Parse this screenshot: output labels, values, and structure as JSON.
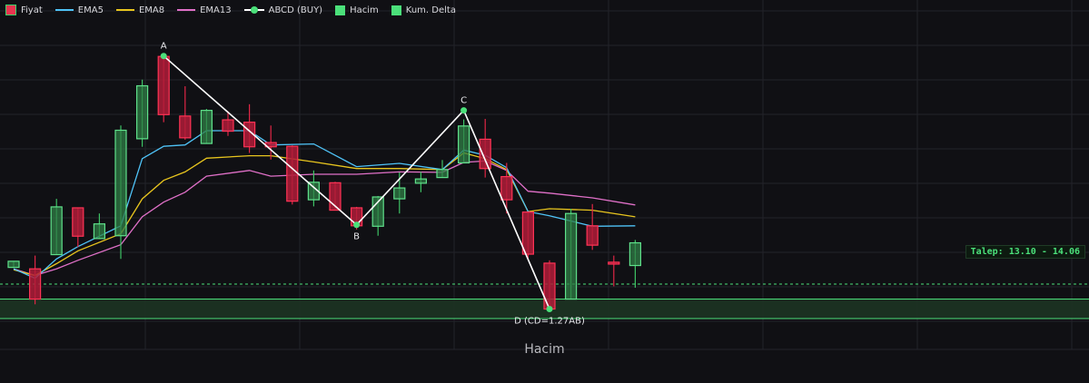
{
  "legend": [
    {
      "icon": "candlestick-icon",
      "label": "Fiyat",
      "style": "candle",
      "color": "#e8354f"
    },
    {
      "icon": "line-icon",
      "label": "EMA5",
      "style": "line",
      "color": "#4fc3f7"
    },
    {
      "icon": "line-icon",
      "label": "EMA8",
      "style": "line",
      "color": "#e8c51e"
    },
    {
      "icon": "line-icon",
      "label": "EMA13",
      "style": "line",
      "color": "#e070c8"
    },
    {
      "icon": "abcd-pattern-icon",
      "label": "ABCD (BUY)",
      "style": "abcd",
      "color": "#ffffff"
    },
    {
      "icon": "square-icon",
      "label": "Hacim",
      "style": "square",
      "color": "#4be07a"
    },
    {
      "icon": "square-icon",
      "label": "Kum. Delta",
      "style": "square",
      "color": "#4be07a"
    }
  ],
  "colors": {
    "background": "#101014",
    "grid": "#22232a",
    "bull": "#3ec264",
    "bear": "#e02645",
    "ema5": "#4fc3f7",
    "ema8": "#e8c51e",
    "ema13": "#e070c8",
    "abcd": "#ffffff",
    "abcd_point": "#4be07a",
    "demand_fill": "#1c3322",
    "demand_line": "#4be07a"
  },
  "demand_zone": {
    "label": "Talep: 13.10 - 14.06",
    "low": 13.1,
    "high": 14.06
  },
  "volume_panel": {
    "title": "Hacim"
  },
  "chart_data": {
    "type": "candlestick",
    "ylim": [
      12.9,
      20.0
    ],
    "candles": [
      {
        "x": 0,
        "o": 14.73,
        "h": 14.86,
        "l": 14.73,
        "c": 14.86
      },
      {
        "x": 1,
        "o": 14.7,
        "h": 14.98,
        "l": 13.95,
        "c": 14.06
      },
      {
        "x": 2,
        "o": 15.0,
        "h": 16.18,
        "l": 15.0,
        "c": 16.01
      },
      {
        "x": 3,
        "o": 15.99,
        "h": 15.99,
        "l": 15.16,
        "c": 15.39
      },
      {
        "x": 4,
        "o": 15.34,
        "h": 15.87,
        "l": 15.34,
        "c": 15.65
      },
      {
        "x": 5,
        "o": 15.4,
        "h": 17.73,
        "l": 14.91,
        "c": 17.63
      },
      {
        "x": 6,
        "o": 17.45,
        "h": 18.7,
        "l": 17.28,
        "c": 18.57
      },
      {
        "x": 7,
        "o": 19.19,
        "h": 19.2,
        "l": 17.8,
        "c": 17.96
      },
      {
        "x": 8,
        "o": 17.93,
        "h": 18.56,
        "l": 17.43,
        "c": 17.47
      },
      {
        "x": 9,
        "o": 17.35,
        "h": 18.08,
        "l": 17.35,
        "c": 18.05
      },
      {
        "x": 10,
        "o": 17.85,
        "h": 18.03,
        "l": 17.51,
        "c": 17.61
      },
      {
        "x": 11,
        "o": 17.8,
        "h": 18.18,
        "l": 17.15,
        "c": 17.28
      },
      {
        "x": 12,
        "o": 17.37,
        "h": 17.73,
        "l": 17.01,
        "c": 17.28
      },
      {
        "x": 13,
        "o": 17.29,
        "h": 17.31,
        "l": 16.06,
        "c": 16.13
      },
      {
        "x": 14,
        "o": 16.16,
        "h": 16.78,
        "l": 16.02,
        "c": 16.53
      },
      {
        "x": 15,
        "o": 16.52,
        "h": 16.54,
        "l": 15.97,
        "c": 15.94
      },
      {
        "x": 16,
        "o": 15.99,
        "h": 16.01,
        "l": 15.53,
        "c": 15.61
      },
      {
        "x": 17,
        "o": 15.6,
        "h": 16.24,
        "l": 15.4,
        "c": 16.22
      },
      {
        "x": 18,
        "o": 16.18,
        "h": 16.74,
        "l": 15.87,
        "c": 16.41
      },
      {
        "x": 19,
        "o": 16.51,
        "h": 16.75,
        "l": 16.32,
        "c": 16.6
      },
      {
        "x": 20,
        "o": 16.63,
        "h": 17.0,
        "l": 16.63,
        "c": 16.8
      },
      {
        "x": 21,
        "o": 16.94,
        "h": 17.86,
        "l": 16.94,
        "c": 17.72
      },
      {
        "x": 22,
        "o": 17.44,
        "h": 17.87,
        "l": 16.63,
        "c": 16.82
      },
      {
        "x": 23,
        "o": 16.65,
        "h": 16.94,
        "l": 15.87,
        "c": 16.16
      },
      {
        "x": 24,
        "o": 15.9,
        "h": 15.91,
        "l": 14.89,
        "c": 15.01
      },
      {
        "x": 25,
        "o": 14.82,
        "h": 14.88,
        "l": 13.85,
        "c": 13.85
      },
      {
        "x": 26,
        "o": 14.06,
        "h": 15.97,
        "l": 14.06,
        "c": 15.87
      },
      {
        "x": 27,
        "o": 15.61,
        "h": 16.07,
        "l": 15.1,
        "c": 15.2
      },
      {
        "x": 28,
        "o": 14.84,
        "h": 14.98,
        "l": 14.33,
        "c": 14.8
      },
      {
        "x": 29,
        "o": 14.77,
        "h": 15.31,
        "l": 14.3,
        "c": 15.25
      }
    ],
    "ema5": [
      [
        0,
        14.7
      ],
      [
        1,
        14.5
      ],
      [
        2,
        14.91
      ],
      [
        3,
        15.17
      ],
      [
        5,
        15.61
      ],
      [
        6,
        17.03
      ],
      [
        7,
        17.29
      ],
      [
        8,
        17.32
      ],
      [
        9,
        17.62
      ],
      [
        11,
        17.62
      ],
      [
        12,
        17.32
      ],
      [
        14,
        17.34
      ],
      [
        16,
        16.86
      ],
      [
        18,
        16.93
      ],
      [
        20,
        16.8
      ],
      [
        21,
        17.21
      ],
      [
        22,
        17.1
      ],
      [
        23,
        16.84
      ],
      [
        24,
        15.91
      ],
      [
        25,
        15.82
      ],
      [
        27,
        15.6
      ],
      [
        29,
        15.61
      ]
    ],
    "ema8": [
      [
        0,
        14.68
      ],
      [
        1,
        14.56
      ],
      [
        2,
        14.81
      ],
      [
        3,
        15.08
      ],
      [
        5,
        15.44
      ],
      [
        6,
        16.18
      ],
      [
        7,
        16.57
      ],
      [
        8,
        16.75
      ],
      [
        9,
        17.04
      ],
      [
        11,
        17.09
      ],
      [
        12,
        17.09
      ],
      [
        14,
        16.96
      ],
      [
        16,
        16.82
      ],
      [
        18,
        16.82
      ],
      [
        20,
        16.8
      ],
      [
        21,
        17.15
      ],
      [
        22,
        17.03
      ],
      [
        23,
        16.8
      ],
      [
        24,
        15.91
      ],
      [
        25,
        15.97
      ],
      [
        27,
        15.94
      ],
      [
        29,
        15.8
      ]
    ],
    "ema13": [
      [
        0,
        14.7
      ],
      [
        1,
        14.56
      ],
      [
        2,
        14.7
      ],
      [
        3,
        14.88
      ],
      [
        5,
        15.21
      ],
      [
        6,
        15.8
      ],
      [
        7,
        16.11
      ],
      [
        8,
        16.32
      ],
      [
        9,
        16.66
      ],
      [
        11,
        16.78
      ],
      [
        12,
        16.66
      ],
      [
        14,
        16.7
      ],
      [
        16,
        16.7
      ],
      [
        18,
        16.75
      ],
      [
        20,
        16.74
      ],
      [
        21,
        16.95
      ],
      [
        22,
        16.98
      ],
      [
        23,
        16.78
      ],
      [
        24,
        16.34
      ],
      [
        25,
        16.3
      ],
      [
        27,
        16.2
      ],
      [
        29,
        16.05
      ]
    ],
    "abcd": [
      {
        "label": "A",
        "x": 7,
        "y": 19.2
      },
      {
        "label": "B",
        "x": 16,
        "y": 15.63
      },
      {
        "label": "C",
        "x": 21,
        "y": 18.05
      },
      {
        "label": "D (CD=1.27AB)",
        "x": 25,
        "y": 13.85
      }
    ]
  }
}
